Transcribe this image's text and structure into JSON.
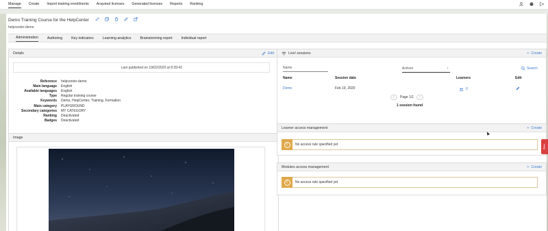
{
  "topnav": {
    "items": [
      "Manage",
      "Create",
      "Import training enrollments",
      "Acquired licenses",
      "Generated licenses",
      "Reports",
      "Ranking"
    ],
    "active": "Manage"
  },
  "course": {
    "title": "Demo Training Course for the HelpCenter",
    "subtitle": "helpcenter-demo"
  },
  "tabs": {
    "items": [
      "Administration",
      "Authoring",
      "Key indicators",
      "Learning analytics",
      "Brainstorming report",
      "Individual report"
    ],
    "active": "Administration"
  },
  "details": {
    "header": "Details",
    "edit_label": "Edit",
    "published": "Last published on 19/02/2020 at 8:39:42",
    "fields": [
      {
        "key": "Reference",
        "value": "helpcenter-demo"
      },
      {
        "key": "Main language",
        "value": "English"
      },
      {
        "key": "Available languages",
        "value": "English"
      },
      {
        "key": "Type",
        "value": "Regular training course"
      },
      {
        "key": "Keywords",
        "value": "Demo, HelpCenter, Training, Formation"
      },
      {
        "key": "Main category",
        "value": "PLAYGROUND"
      },
      {
        "key": "Secondary categories",
        "value": "MY CATEGORY"
      },
      {
        "key": "Ranking",
        "value": "Deactivated"
      },
      {
        "key": "Badges",
        "value": "Deactivated"
      }
    ]
  },
  "image_panel": {
    "header": "Image"
  },
  "live_sessions": {
    "header": "Live! sessions",
    "create_label": "Create",
    "name_placeholder": "Name",
    "status_select": "Actives",
    "search_label": "Search",
    "columns": [
      "Name",
      "Session date",
      "Learners",
      "Edit"
    ],
    "rows": [
      {
        "name": "Demo",
        "date": "Feb 19, 2020",
        "learners": "0"
      }
    ],
    "page": "Page 1/1",
    "found": "1 session found"
  },
  "learner_access": {
    "header": "Learner access management",
    "create_label": "Create",
    "alert": "No access rule specified yet"
  },
  "modules_access": {
    "header": "Modules access management",
    "create_label": "Create",
    "alert": "No access rule specified yet"
  },
  "help_tab": "Help",
  "colors": {
    "accent": "#3b7bd1",
    "warning": "#e0a84a",
    "help": "#d94040"
  }
}
